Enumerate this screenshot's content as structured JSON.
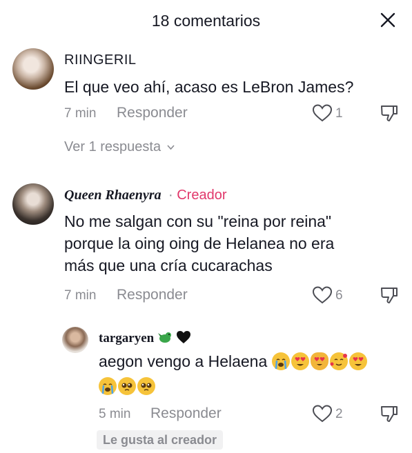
{
  "header": {
    "title": "18 comentarios"
  },
  "comments": [
    {
      "username": "RIINGERIL",
      "text": "El que veo ahí, acaso es LeBron James?",
      "time": "7 min",
      "reply_label": "Responder",
      "likes": "1",
      "view_replies": "Ver 1 respuesta"
    },
    {
      "username": "Queen Rhaenyra",
      "separator": " · ",
      "creator_tag": "Creador",
      "text_lines": [
        "No me salgan con su \"reina por reina\"",
        "porque la oing oing de Helanea no era",
        "más que una cría cucarachas"
      ],
      "time": "7 min",
      "reply_label": "Responder",
      "likes": "6"
    }
  ],
  "reply": {
    "username": "targaryen",
    "text": "aegon vengo a Helaena",
    "time": "5 min",
    "reply_label": "Responder",
    "likes": "2",
    "liked_by_creator": "Le gusta al creador"
  },
  "colors": {
    "creator_accent": "#e1386b",
    "muted": "#8a8b91",
    "text": "#161823"
  }
}
